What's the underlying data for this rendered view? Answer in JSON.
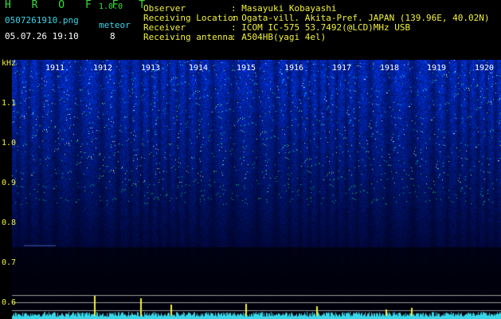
{
  "app": {
    "title": "H R O F F T",
    "version": "1.0.0"
  },
  "file": {
    "name": "0507261910.png",
    "date_time": "05.07.26 19:10"
  },
  "meteor": {
    "label": "meteor",
    "count": "8"
  },
  "info": {
    "observer_label": "Observer",
    "observer_value": ": Masayuki Kobayashi",
    "location_label": "Receiving Location",
    "location_value": ": Ogata-vill. Akita-Pref. JAPAN (139.96E, 40.02N)",
    "receiver_label": "Receiver",
    "receiver_value": ": ICOM IC-575 53.7492(@LCD)MHz USB",
    "antenna_label": "Receiving antenna",
    "antenna_value": ": A504HB(yagi 4el)"
  },
  "axis": {
    "unit": "kHz",
    "y_ticks": [
      "1.1",
      "1.0",
      "0.9",
      "0.8",
      "0.7",
      "0.6"
    ],
    "x_ticks": [
      "1911",
      "1912",
      "1913",
      "1914",
      "1915",
      "1916",
      "1917",
      "1918",
      "1919",
      "1920"
    ]
  },
  "colors": {
    "background": "#000000",
    "spectrum": "#1a3aff",
    "label_yellow": "#f2f23a",
    "label_green": "#34e034",
    "trace_cyan": "#3ad6e8"
  }
}
